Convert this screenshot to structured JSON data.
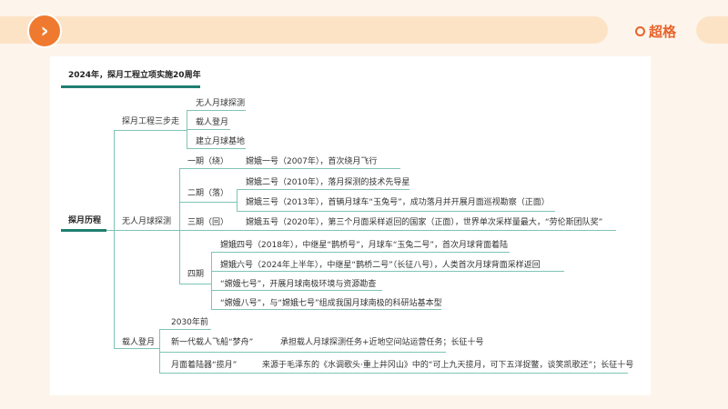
{
  "header": {
    "logo_text": "超格",
    "nav_icon": "chevron-right-icon"
  },
  "mindmap": {
    "title": "2024年，探月工程立项实施20周年",
    "root": "探月历程",
    "three_steps": {
      "label": "探月工程三步走",
      "items": [
        "无人月球探测",
        "载人登月",
        "建立月球基地"
      ]
    },
    "unmanned": {
      "label": "无人月球探测",
      "phase1": {
        "label": "一期（绕）",
        "items": [
          "嫦娥一号（2007年），首次绕月飞行"
        ]
      },
      "phase2": {
        "label": "二期（落）",
        "items": [
          "嫦娥二号（2010年），落月探测的技术先导星",
          "嫦娥三号（2013年），首辆月球车“玉兔号”，成功落月并开展月面巡视勘察（正面）"
        ]
      },
      "phase3": {
        "label": "三期（回）",
        "items": [
          "嫦娥五号（2020年），第三个月面采样返回的国家（正面），世界单次采样量最大，“劳伦斯团队奖”"
        ]
      },
      "phase4": {
        "label": "四期",
        "items": [
          "嫦娥四号（2018年），中继星“鹊桥号”，月球车“玉兔二号”，首次月球背面着陆",
          "嫦娥六号（2024年上半年），中继星“鹊桥二号”（长征八号），人类首次月球背面采样返回",
          "“嫦娥七号”，开展月球南极环境与资源勘查",
          "“嫦娥八号”，与“嫦娥七号”组成我国月球南极的科研站基本型"
        ]
      }
    },
    "manned": {
      "label": "载人登月",
      "timeframe": "2030年前",
      "items": [
        {
          "name": "新一代载人飞船“梦舟”",
          "desc": "承担载人月球探测任务+近地空间站运营任务；长征十号"
        },
        {
          "name": "月面着陆器“揽月”",
          "desc": "来源于毛泽东的《水调歌头·重上井冈山》中的“可上九天揽月，可下五洋捉鳖，谈笑凯歌还”；长征十号"
        }
      ]
    }
  }
}
